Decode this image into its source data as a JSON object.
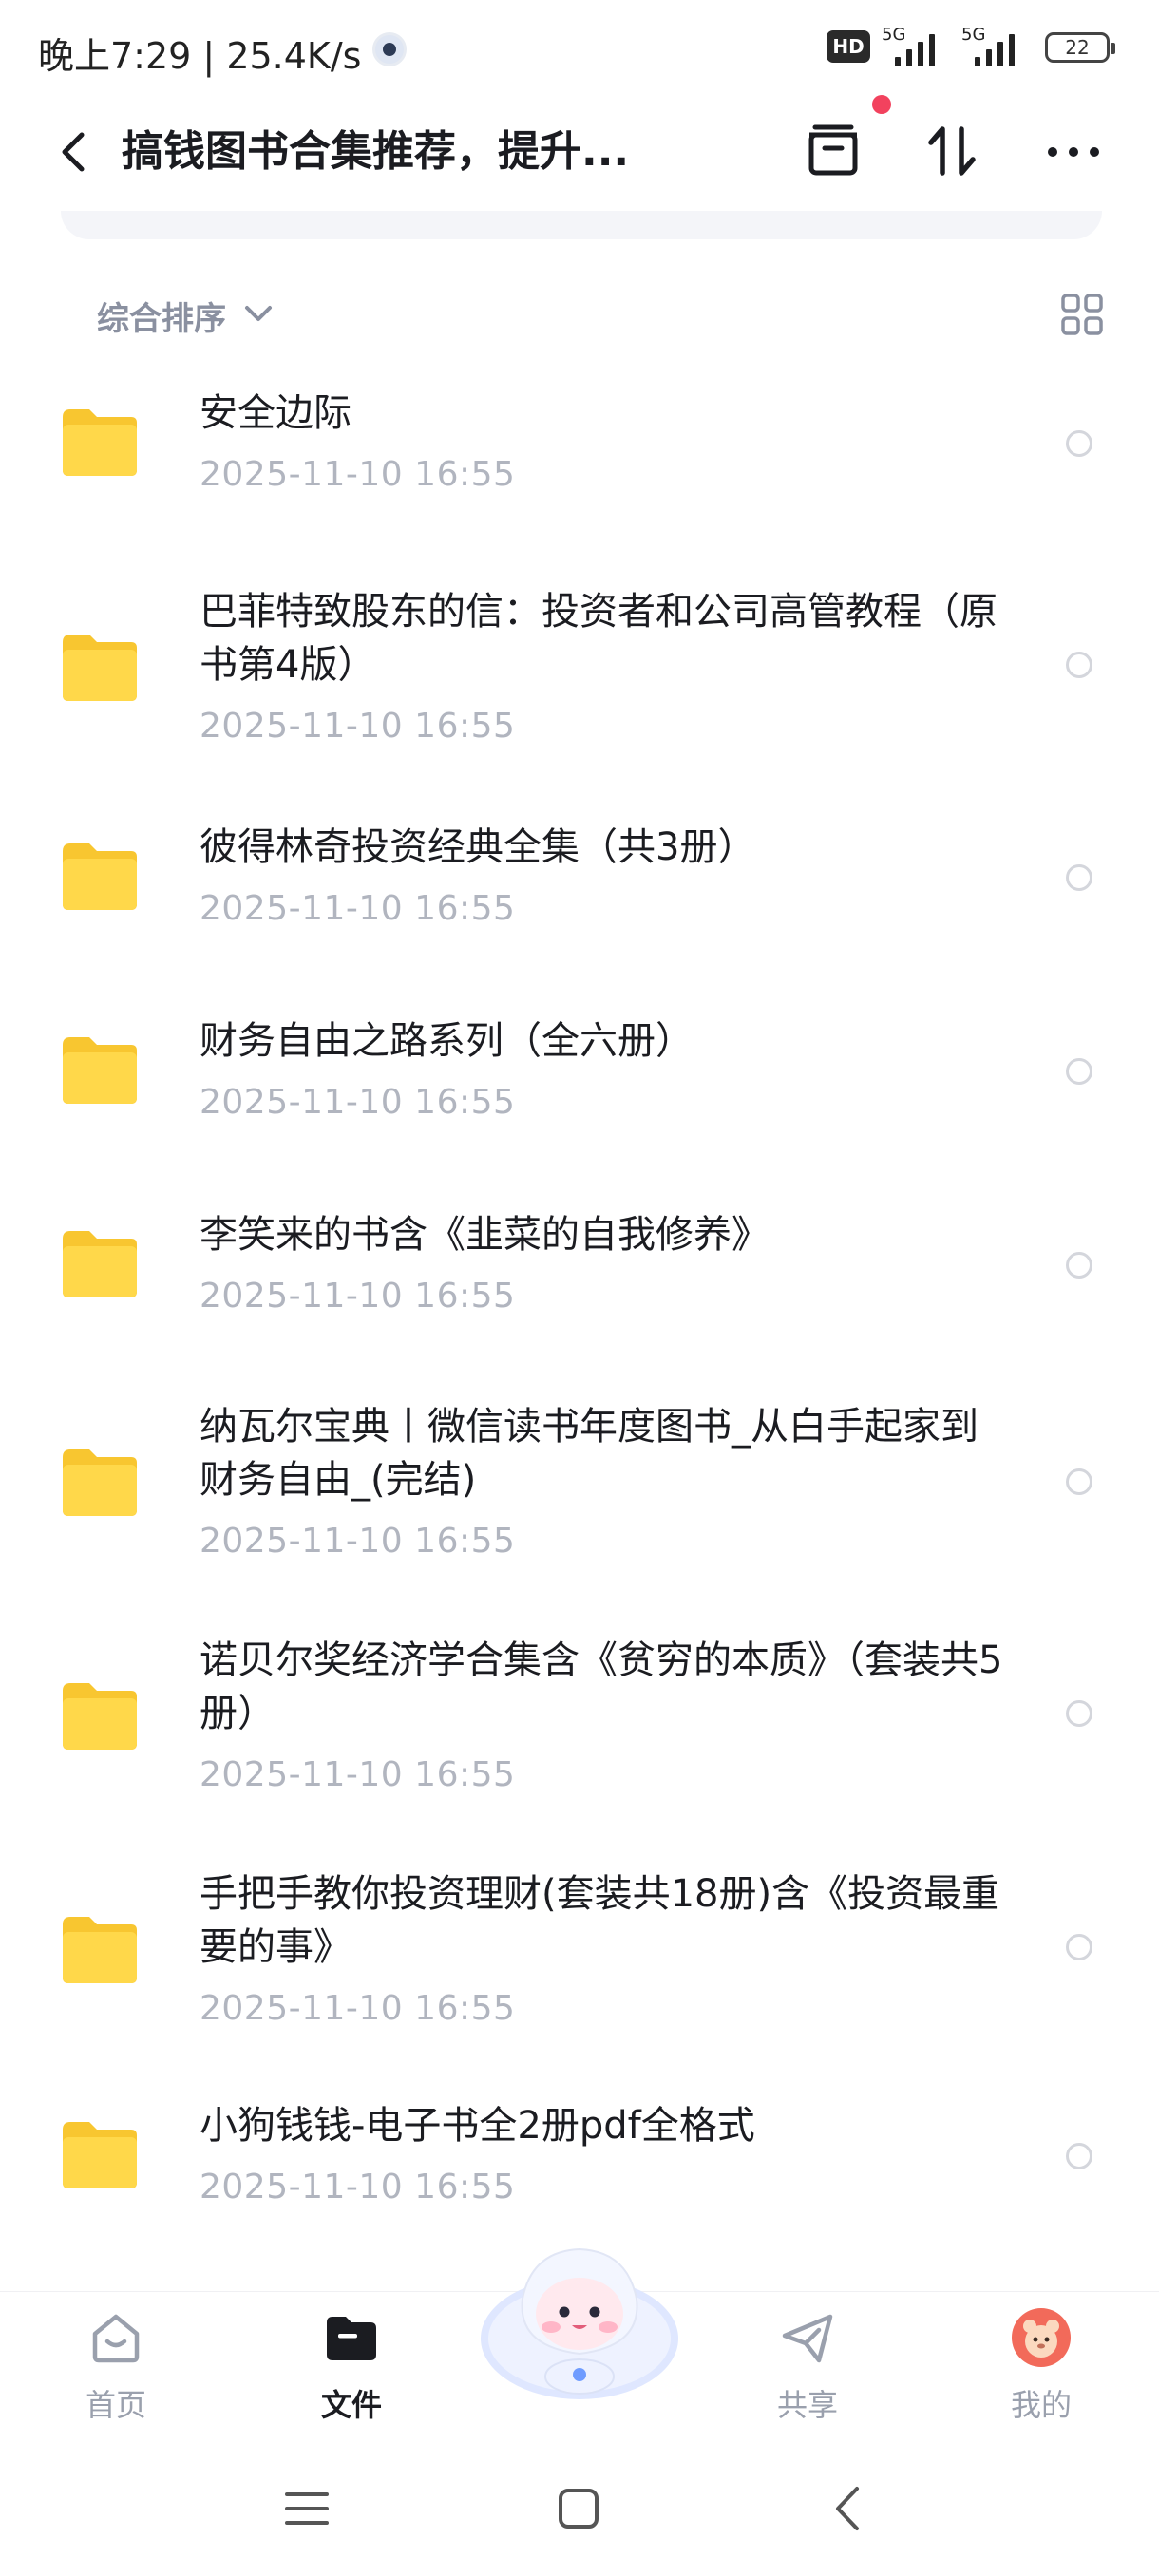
{
  "status_bar": {
    "time": "晚上7:29",
    "speed": "25.4K/s",
    "hd_badge": "HD",
    "net1": "5G",
    "net2": "5G",
    "battery": "22"
  },
  "header": {
    "title": "搞钱图书合集推荐，提升..."
  },
  "toolbar": {
    "sort_label": "综合排序"
  },
  "files": [
    {
      "name": "安全边际",
      "date": "2025-11-10  16:55"
    },
    {
      "name": "巴菲特致股东的信：投资者和公司高管教程（原书第4版）",
      "date": "2025-11-10  16:55"
    },
    {
      "name": "彼得林奇投资经典全集（共3册）",
      "date": "2025-11-10  16:55"
    },
    {
      "name": "财务自由之路系列（全六册）",
      "date": "2025-11-10  16:55"
    },
    {
      "name": "李笑来的书含《韭菜的自我修养》",
      "date": "2025-11-10  16:55"
    },
    {
      "name": "纳瓦尔宝典丨微信读书年度图书_从白手起家到财务自由_(完结)",
      "date": "2025-11-10  16:55"
    },
    {
      "name": "诺贝尔奖经济学合集含《贫穷的本质》（套装共5册）",
      "date": "2025-11-10  16:55"
    },
    {
      "name": "手把手教你投资理财(套装共18册)含《投资最重要的事》",
      "date": "2025-11-10  16:55"
    },
    {
      "name": "小狗钱钱-电子书全2册pdf全格式",
      "date": "2025-11-10  16:55"
    }
  ],
  "bottom_nav": [
    {
      "label": "首页",
      "icon": "home-icon"
    },
    {
      "label": "文件",
      "icon": "folder-icon",
      "active": true
    },
    {
      "label": "共享",
      "icon": "share-icon"
    },
    {
      "label": "我的",
      "icon": "avatar-icon"
    }
  ],
  "colors": {
    "folder": "#ffd43b",
    "accent_dot": "#f2425e",
    "secondary_text": "#b1b5bf"
  }
}
